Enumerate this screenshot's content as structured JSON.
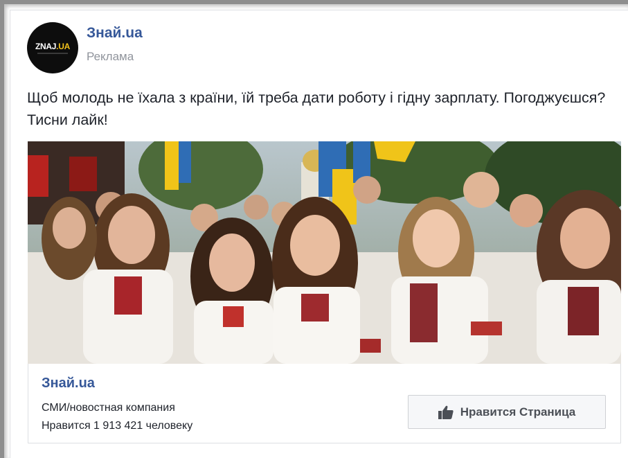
{
  "post": {
    "page_name": "Знай.ua",
    "sponsored_label": "Реклама",
    "text": "Щоб молодь не їхала з країни, їй треба дати роботу і гідну зарплату. Погоджуєшся? Тисни лайк!",
    "avatar": {
      "logo_main": "ZNAJ",
      "logo_dot": ".",
      "logo_ua": "UA"
    }
  },
  "link_box": {
    "name": "Знай.ua",
    "category": "СМИ/новостная компания",
    "likes": "Нравится 1 913 421 человеку",
    "button_label": "Нравится Страница",
    "button_icon": "thumbs-up-icon"
  },
  "colors": {
    "link_blue": "#365899",
    "muted_gray": "#90949c",
    "text": "#1d2129",
    "button_bg": "#f6f7f9"
  }
}
